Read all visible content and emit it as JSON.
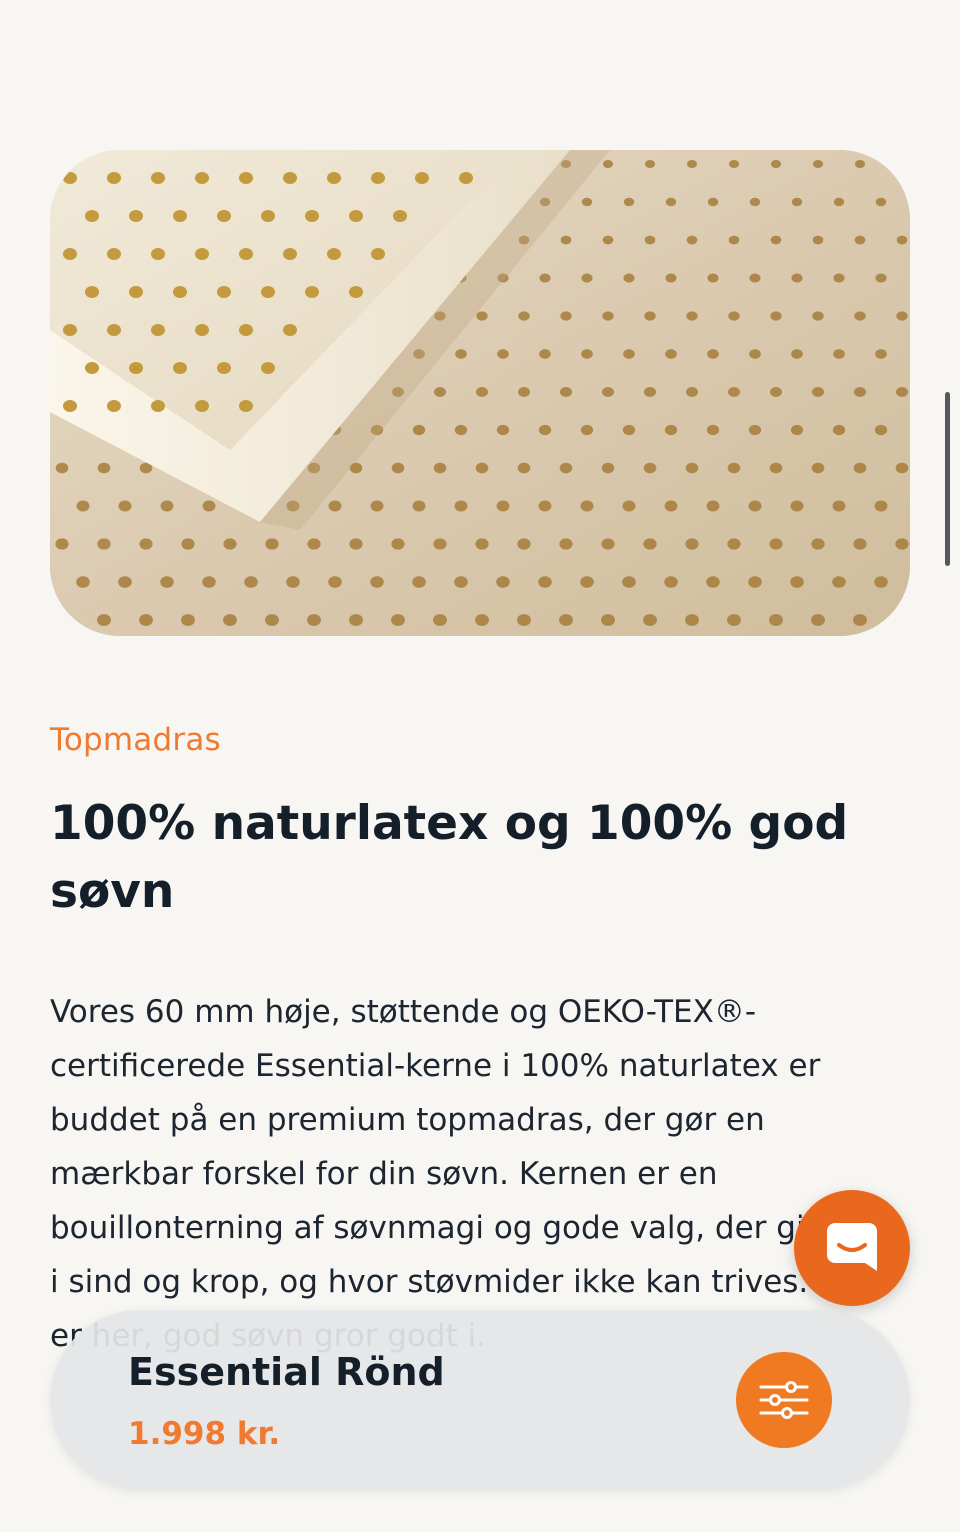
{
  "hero": {
    "image": "perforated-latex-topper-photo"
  },
  "content": {
    "eyebrow": "Topmadras",
    "headline": "100% naturlatex og 100% god søvn",
    "body": "Vores 60 mm høje, støttende og OEKO-TEX®-certificerede Essential-kerne i 100% naturlatex er buddet på en premium topmadras, der gør en mærkbar forskel for din søvn. Kernen er en bouillonterning af søvnmagi og gode valg, der giver ro i sind og krop, og hvor støvmider ikke kan trives. Det er her, god søvn gror godt i."
  },
  "chat": {
    "icon": "chat-icon"
  },
  "sticky_bar": {
    "product_name": "Essential Rönd",
    "price": "1.998 kr.",
    "filter_icon": "sliders-icon"
  },
  "colors": {
    "accent": "#ef7a30",
    "chat_bg": "#e9681e",
    "text": "#1c2530",
    "background": "#f7f6f3"
  }
}
